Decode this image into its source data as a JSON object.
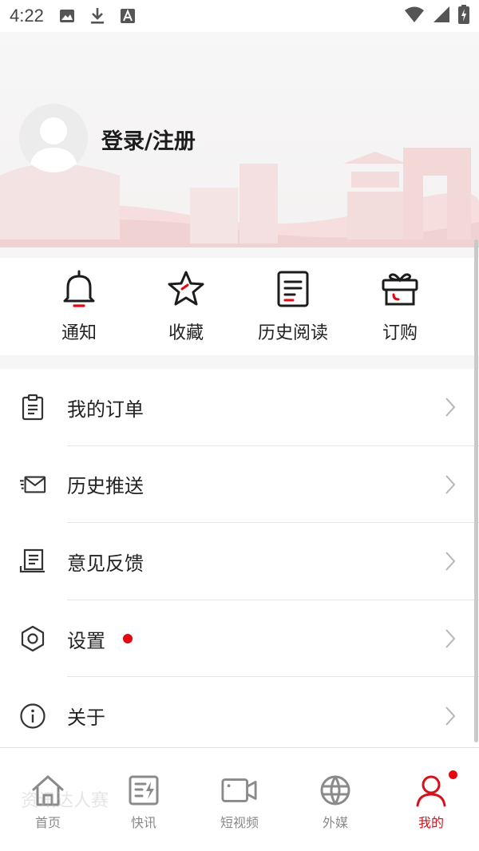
{
  "status_bar": {
    "time": "4:22",
    "icons": [
      "image-icon",
      "download-icon",
      "font-icon",
      "wifi-icon",
      "signal-icon",
      "battery-charging-icon"
    ]
  },
  "profile": {
    "login_label": "登录/注册"
  },
  "quick_actions": [
    {
      "icon": "bell-icon",
      "label": "通知"
    },
    {
      "icon": "star-icon",
      "label": "收藏"
    },
    {
      "icon": "document-icon",
      "label": "历史阅读"
    },
    {
      "icon": "gift-icon",
      "label": "订购"
    }
  ],
  "menu": [
    {
      "icon": "clipboard-icon",
      "label": "我的订单",
      "badge": false
    },
    {
      "icon": "mail-icon",
      "label": "历史推送",
      "badge": false
    },
    {
      "icon": "feedback-icon",
      "label": "意见反馈",
      "badge": false
    },
    {
      "icon": "settings-icon",
      "label": "设置",
      "badge": true
    },
    {
      "icon": "info-icon",
      "label": "关于",
      "badge": false
    }
  ],
  "bottom_nav": [
    {
      "icon": "home-icon",
      "label": "首页",
      "active": false
    },
    {
      "icon": "flash-news-icon",
      "label": "快讯",
      "active": false
    },
    {
      "icon": "video-icon",
      "label": "短视频",
      "active": false
    },
    {
      "icon": "globe-icon",
      "label": "外媒",
      "active": false
    },
    {
      "icon": "user-icon",
      "label": "我的",
      "active": true,
      "badge": true
    }
  ],
  "watermark": "资讯达人赛",
  "colors": {
    "accent": "#e30613",
    "active_nav": "#d3121b",
    "icon_dark": "#1c1c1c",
    "nav_gray": "#8a8a8a"
  }
}
